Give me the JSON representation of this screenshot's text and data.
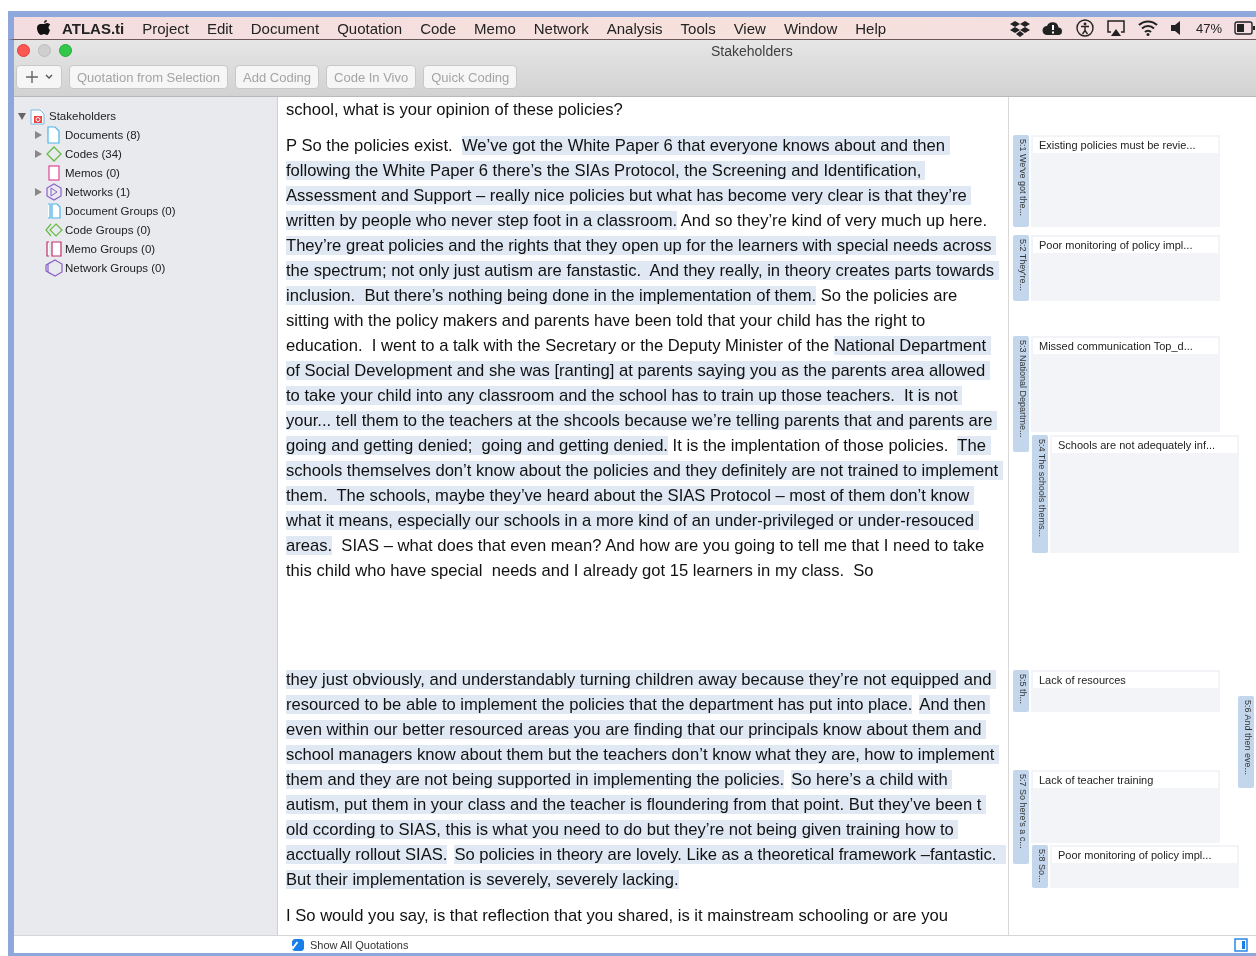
{
  "menu_bar": {
    "app": "ATLAS.ti",
    "items": [
      "Project",
      "Edit",
      "Document",
      "Quotation",
      "Code",
      "Memo",
      "Network",
      "Analysis",
      "Tools",
      "View",
      "Window",
      "Help"
    ],
    "battery": "47%"
  },
  "window": {
    "title": "Stakeholders"
  },
  "toolbar": {
    "buttons": [
      "Quotation from Selection",
      "Add Coding",
      "Code In Vivo",
      "Quick Coding"
    ]
  },
  "navigator": [
    {
      "label": "Stakeholders",
      "kind": "project",
      "expanded": true,
      "children": [
        {
          "label": "Documents (8)",
          "kind": "documents",
          "expanded": false
        },
        {
          "label": "Codes (34)",
          "kind": "codes",
          "expanded": false
        },
        {
          "label": "Memos (0)",
          "kind": "memos"
        },
        {
          "label": "Networks (1)",
          "kind": "networks",
          "expanded": false
        },
        {
          "label": "Document Groups (0)",
          "kind": "document_groups"
        },
        {
          "label": "Code Groups (0)",
          "kind": "code_groups"
        },
        {
          "label": "Memo Groups (0)",
          "kind": "memo_groups"
        },
        {
          "label": "Network Groups (0)",
          "kind": "network_groups"
        }
      ]
    }
  ],
  "document": [
    {
      "segments": [
        {
          "text": "school, what is your opinion of these policies?",
          "quoted": false
        }
      ]
    },
    {
      "segments": [
        {
          "text": "P So the policies exist.  ",
          "quoted": false
        },
        {
          "text": "We’ve got the White Paper 6 that everyone knows about and then following the White Paper 6 there’s the SIAs Protocol, the Screening and Identification, Assessment and Support – really nice policies but what has become very clear is that they’re written by people who never step foot in a classroom.",
          "quoted": true
        },
        {
          "text": " And so they’re kind of very much up here. ",
          "quoted": false
        },
        {
          "text": "They’re great policies and the rights that they open up for the learners with special needs across the spectrum; not only just autism are fanstastic.  And they really, in theory creates parts towards inclusion.  But there’s nothing being done in the implementation of them.",
          "quoted": true
        },
        {
          "text": " So the policies are sitting with the policy makers and parents have been told that your child has the right to education.  I went to a talk with the Secretary or the Deputy Minister of the ",
          "quoted": false
        },
        {
          "text": "National Department of Social Development and she was [ranting] at parents saying you as the parents area allowed to take your child into any classroom and the school has to train up those teachers.  It is not your... tell them to the teachers at the shcools because we’re telling parents that and parents are going and getting denied;  going and getting denied.",
          "quoted": true
        },
        {
          "text": " It is the implentation of those policies.  ",
          "quoted": false
        },
        {
          "text": "The schools themselves don’t know about the policies and they definitely are not trained to implement them.  The schools, maybe they’ve heard about the SIAS Protocol – most of them don’t know what it means, especially our schools in a more kind of an under-privileged or under-resouced areas.",
          "quoted": true
        },
        {
          "text": "  SIAS – what does that even mean? And how are you going to tell me that I need to take this child who have special  needs and I already got 15 learners in my class.  So",
          "quoted": false
        }
      ]
    },
    {
      "segments": [
        {
          "text": "they just obviously, and understandably turning children away because they’re not equipped and resourced to be able to implement the policies that the department has put into place.",
          "quoted": true
        },
        {
          "text": "And then even within our better resourced areas you are finding that our principals know about them and school managers know about them but the teachers don’t know what they are, how to implement them and they are not being supported in implementing the policies.",
          "quoted": true
        },
        {
          "text": "So here’s a child with autism, put them in your class and the teacher is floundering from that point. But they’ve been t old ccording to SIAS, this is what you need to do but they’re not being given training how to acctually rollout SIAS.",
          "quoted": true
        },
        {
          "text": "So policies in theory are lovely. Like as a theoretical framework –fantastic.  But their implementation is severely, severely lacking.",
          "quoted": true
        }
      ]
    },
    {
      "segments": [
        {
          "text": "I So would you say, is that reflection that you shared, is it mainstream schooling or are you",
          "quoted": false
        }
      ]
    }
  ],
  "quotations": [
    {
      "tag": "5:1 We've got the...",
      "code": "Existing policies must be revie..."
    },
    {
      "tag": "5:2 They're...",
      "code": "Poor monitoring of policy impl..."
    },
    {
      "tag": "5:3 National Departme...",
      "code": "Missed communication Top_d..."
    },
    {
      "tag": "5:4 The schools thems...",
      "code": "Schools are not adequately inf..."
    },
    {
      "tag": "5:5 th...",
      "code": "Lack of resources"
    },
    {
      "tag": "5:6 And then eve..."
    },
    {
      "tag": "5:7 So here's a c...",
      "code": "Lack of teacher training"
    },
    {
      "tag": "5:8 So...",
      "code": "Poor monitoring of policy impl..."
    }
  ],
  "footer": {
    "label": "Show All Quotations",
    "checked": true
  }
}
